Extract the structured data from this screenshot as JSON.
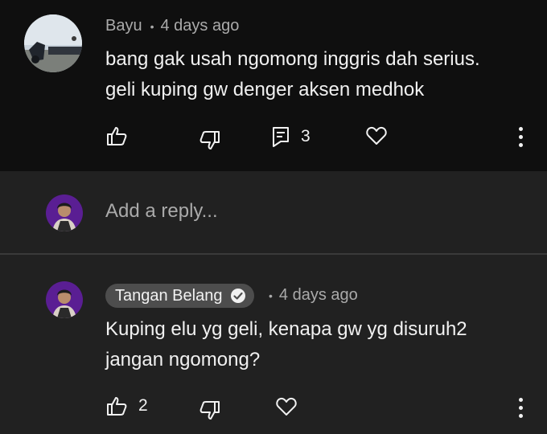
{
  "top_comment": {
    "author": "Bayu",
    "time": "4 days ago",
    "lines": [
      "bang gak usah ngomong inggris dah serius.",
      "geli kuping gw denger aksen medhok"
    ],
    "reply_count": "3"
  },
  "reply_box": {
    "placeholder": "Add a reply..."
  },
  "reply_comment": {
    "author": "Tangan Belang",
    "time": "4 days ago",
    "lines": [
      "Kuping elu yg geli, kenapa gw yg disuruh2",
      "jangan ngomong?"
    ],
    "like_count": "2"
  },
  "colors": {
    "top_background": "#0f0f0f",
    "thread_background": "#212121",
    "secondary_text": "#aaaaaa",
    "badge_background": "#4d4d4d"
  },
  "icons": [
    "like-icon",
    "dislike-icon",
    "reply-icon",
    "heart-icon",
    "more-vert-icon",
    "verified-check-icon"
  ]
}
